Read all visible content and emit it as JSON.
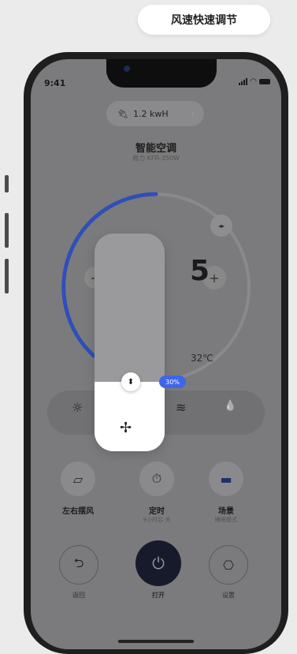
{
  "caption": "风速快速调节",
  "status": {
    "time": "9:41"
  },
  "power": {
    "value": "1.2 kwH",
    "chevron": "›"
  },
  "device": {
    "name": "智能空调",
    "model": "格力 KFR-350W"
  },
  "temperature": {
    "target_digit": "5",
    "minus": "−",
    "plus": "+",
    "outdoor": "32℃"
  },
  "fan_slider": {
    "level_percent": 30,
    "badge": "30%",
    "knob_glyph": "⬍"
  },
  "icons": {
    "arrows": "◂▸",
    "sun": "☼",
    "wind": "≋",
    "drop": "💧",
    "fan": "✢",
    "swing": "▱",
    "timer": "⏱",
    "bed": "▬",
    "undo": "⮌",
    "power": "⏻",
    "gear": "⎔"
  },
  "mode_bar": {
    "modes": [
      "cool-sun",
      "fan",
      "wind",
      "dry"
    ]
  },
  "actions": [
    {
      "label": "左右摆风",
      "sub": ""
    },
    {
      "label": "定时",
      "sub": "9小时后 关"
    },
    {
      "label": "场景",
      "sub": "睡眠模式"
    }
  ],
  "bottom": [
    {
      "label": "返回"
    },
    {
      "label": "打开"
    },
    {
      "label": "设置"
    }
  ],
  "colors": {
    "accent": "#3e66e8",
    "arc": "#2f4fb8",
    "power_button": "#161a2a"
  }
}
